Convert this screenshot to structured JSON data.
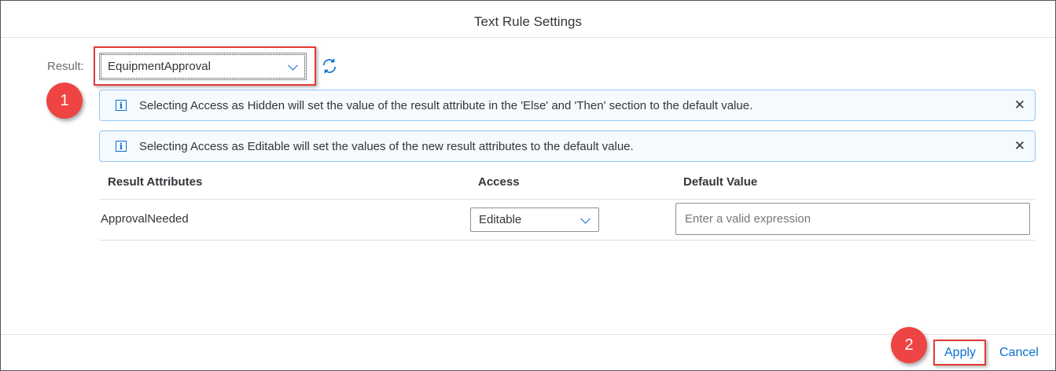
{
  "dialog": {
    "title": "Text Rule Settings"
  },
  "result": {
    "label": "Result:",
    "value": "EquipmentApproval"
  },
  "messages": [
    {
      "text": "Selecting Access as Hidden will set the value of the result attribute in the 'Else' and 'Then' section to the default value."
    },
    {
      "text": "Selecting Access as Editable will set the values of the new result attributes to the default value."
    }
  ],
  "table": {
    "headers": [
      "Result Attributes",
      "Access",
      "Default Value"
    ],
    "rows": [
      {
        "attribute": "ApprovalNeeded",
        "access": "Editable",
        "default_placeholder": "Enter a valid expression"
      }
    ]
  },
  "footer": {
    "apply": "Apply",
    "cancel": "Cancel"
  },
  "callouts": [
    "1",
    "2"
  ],
  "colors": {
    "accent": "#0a6ed1",
    "callout": "#ef4444"
  }
}
